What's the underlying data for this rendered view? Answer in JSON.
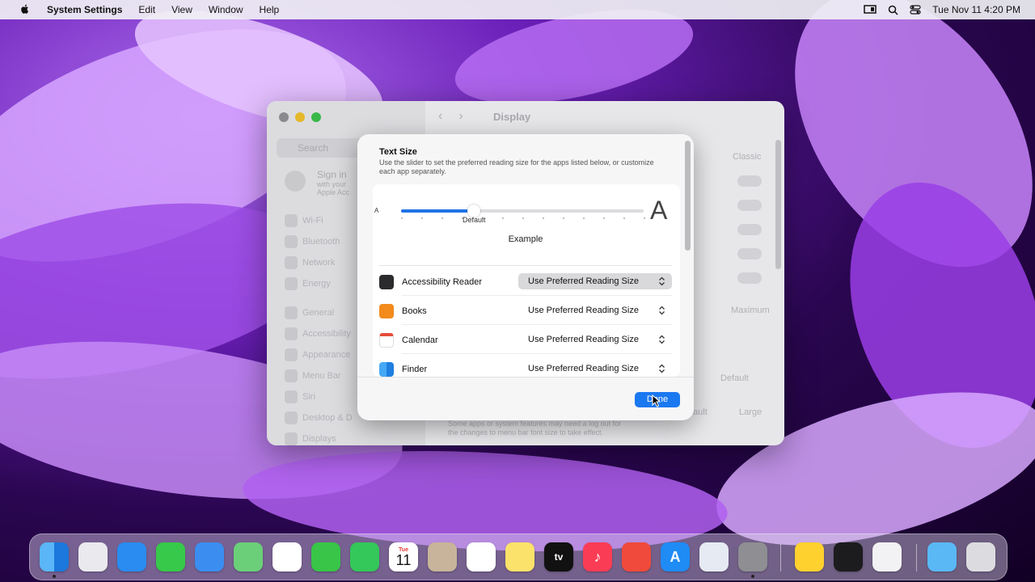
{
  "menubar": {
    "app": "System Settings",
    "items": [
      "Edit",
      "View",
      "Window",
      "Help"
    ],
    "datetime": "Tue Nov 11  4:20 PM"
  },
  "settings": {
    "search_placeholder": "Search",
    "sign_in": "Sign in",
    "sign_in_sub1": "with your",
    "sign_in_sub2": "Apple Acc",
    "sidebar_items": [
      "Wi-Fi",
      "Bluetooth",
      "Network",
      "Energy",
      "General",
      "Accessibility",
      "Appearance",
      "Menu Bar",
      "Siri",
      "Desktop & D",
      "Displays"
    ],
    "title": "Display",
    "ghost_classic": "Classic",
    "ghost_maximum": "Maximum",
    "ghost_default": "Default",
    "ghost_large": "Large",
    "ghost_fault": "fault",
    "ghost_note1": "Some apps or system features may need a log out for",
    "ghost_note2": "the changes to menu bar font size to take effect."
  },
  "dialog": {
    "title": "Text Size",
    "description": "Use the slider to set the preferred reading size for the apps listed below, or customize each app separately.",
    "slider": {
      "small_label": "A",
      "large_label": "A",
      "default_label": "Default",
      "value_fraction": 0.3
    },
    "example": "Example",
    "apps": [
      {
        "name": "Accessibility Reader",
        "setting": "Use Preferred Reading Size",
        "icon": "accessibility-reader-icon",
        "active": true
      },
      {
        "name": "Books",
        "setting": "Use Preferred Reading Size",
        "icon": "books-icon"
      },
      {
        "name": "Calendar",
        "setting": "Use Preferred Reading Size",
        "icon": "calendar-icon"
      },
      {
        "name": "Finder",
        "setting": "Use Preferred Reading Size",
        "icon": "finder-icon"
      }
    ],
    "done_label": "Done"
  },
  "dock": {
    "calendar_month": "Tue",
    "calendar_day": "11",
    "tv_label": "tv"
  }
}
